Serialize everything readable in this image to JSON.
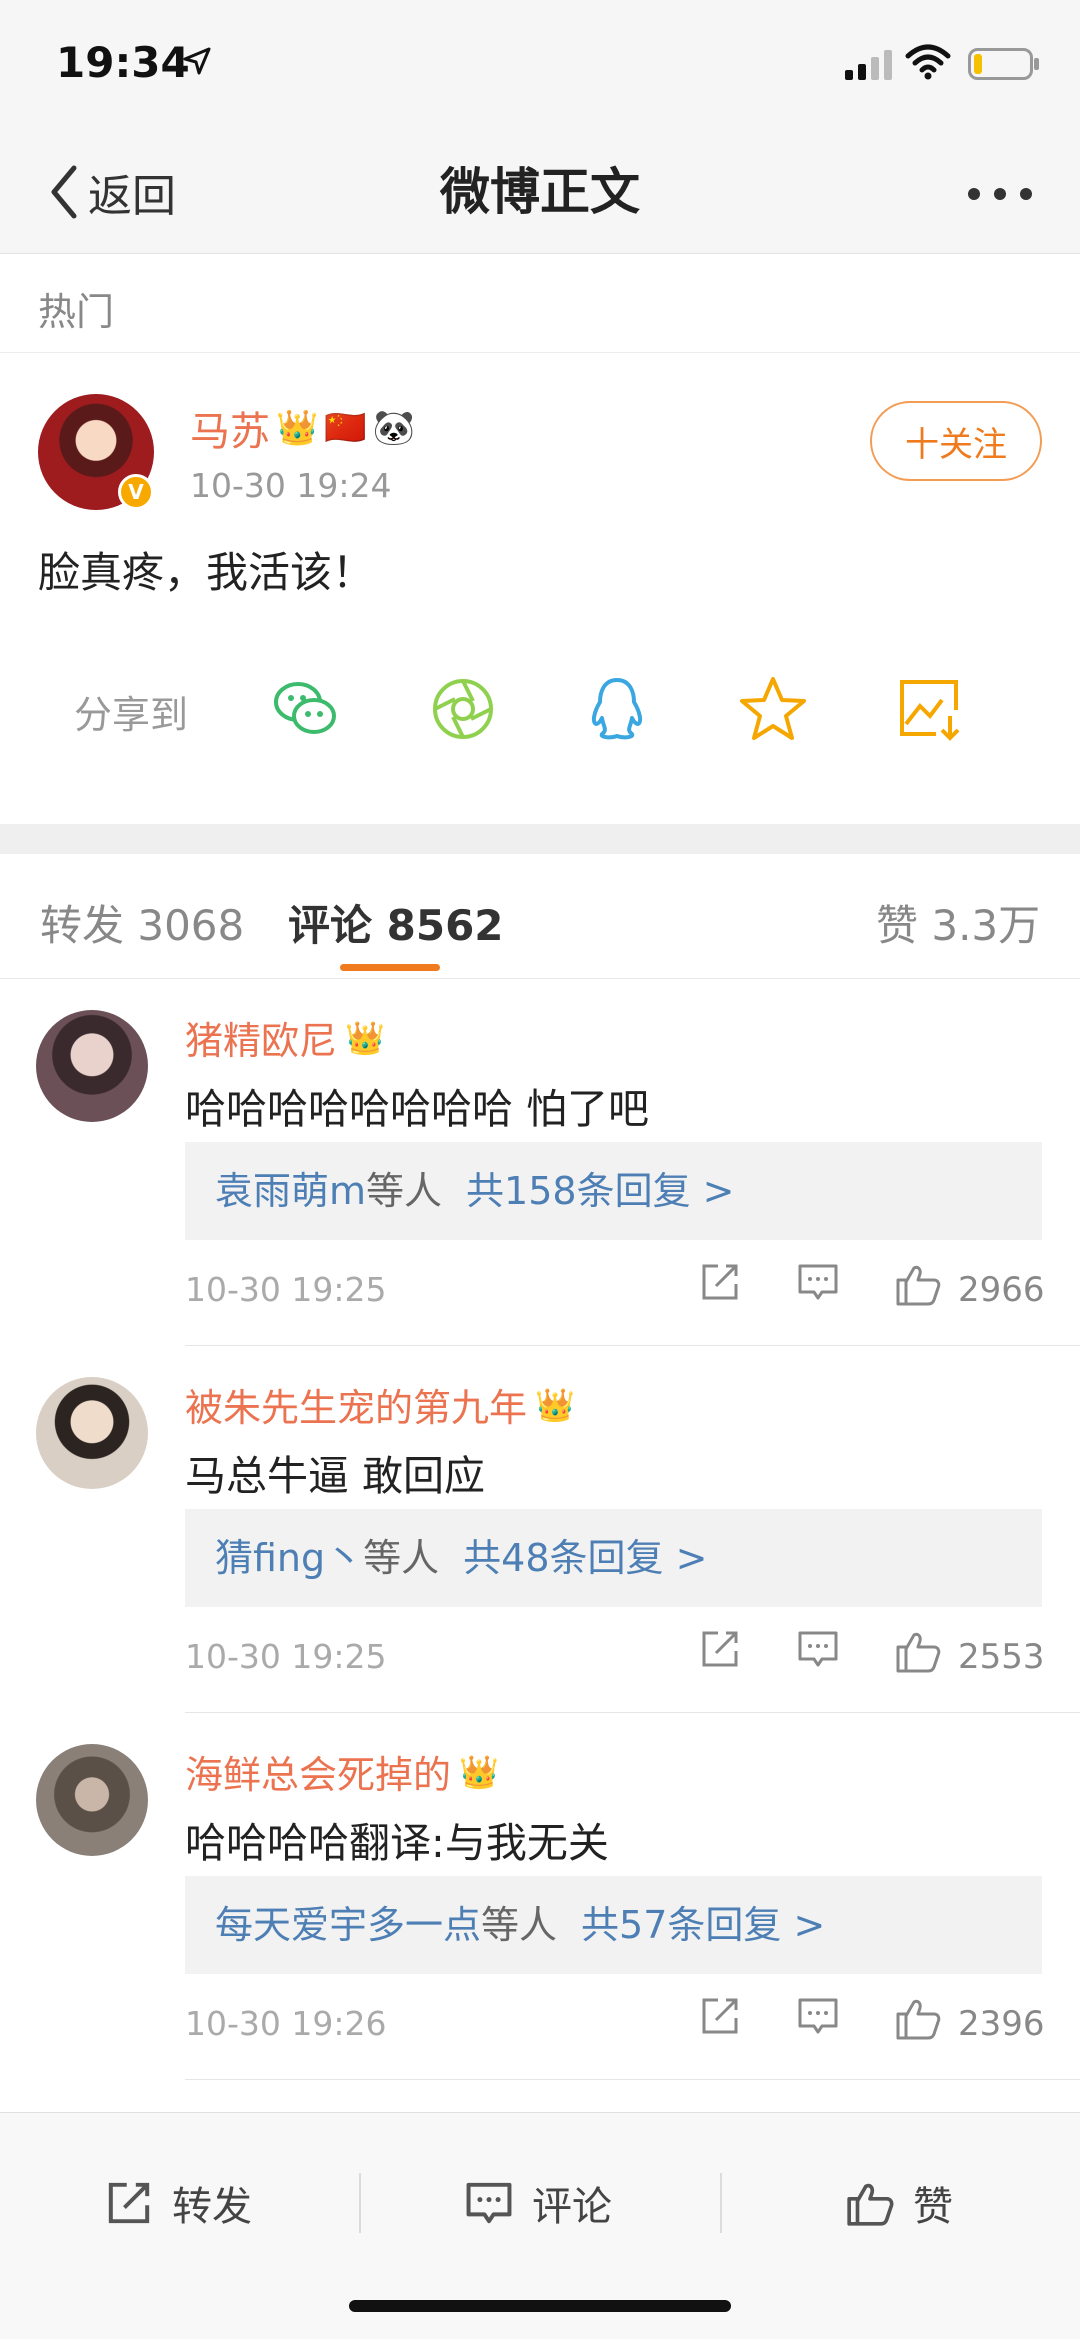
{
  "status_bar": {
    "time": "19:34"
  },
  "nav": {
    "back_label": "返回",
    "title": "微博正文"
  },
  "hot_label": "热门",
  "post": {
    "author": "马苏",
    "author_badges": [
      "👑",
      "🇨🇳",
      "🐼"
    ],
    "verified_badge": "V",
    "time": "10-30 19:24",
    "follow_label": "十关注",
    "text": "脸真疼，我活该！",
    "share_label": "分享到"
  },
  "tabs": {
    "repost": "转发 3068",
    "comments": "评论 8562",
    "likes": "赞 3.3万"
  },
  "comments": [
    {
      "name": "猪精欧尼",
      "text": "哈哈哈哈哈哈哈哈 怕了吧",
      "reply_users": "袁雨萌m",
      "reply_suffix": "等人",
      "reply_count": "共158条回复 >",
      "time": "10-30 19:25",
      "likes": "2966"
    },
    {
      "name": "被朱先生宠的第九年",
      "text": "马总牛逼 敢回应",
      "reply_users": "猜fing丶",
      "reply_suffix": "等人",
      "reply_count": "共48条回复 >",
      "time": "10-30 19:25",
      "likes": "2553"
    },
    {
      "name": "海鲜总会死掉的",
      "text": "哈哈哈哈翻译:与我无关",
      "reply_users": "每天爱宇多一点",
      "reply_suffix": "等人",
      "reply_count": "共57条回复 >",
      "time": "10-30 19:26",
      "likes": "2396"
    }
  ],
  "bottom_bar": {
    "repost": "转发",
    "comment": "评论",
    "like": "赞"
  },
  "colors": {
    "accent": "#f07b1f",
    "username": "#eb7350",
    "link": "#4d7fb5"
  }
}
